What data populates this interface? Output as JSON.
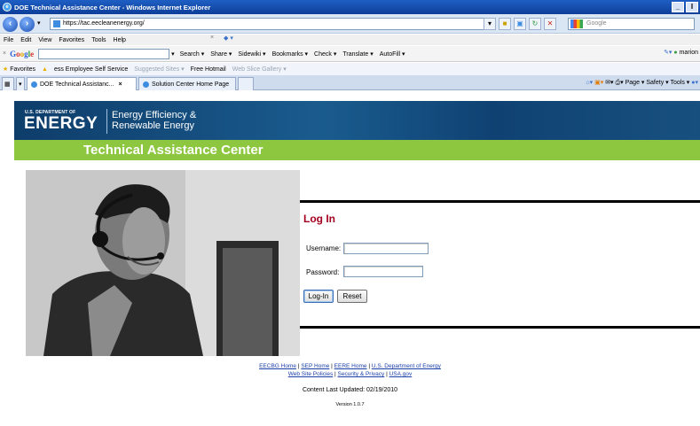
{
  "window": {
    "title": "DOE Technical Assistance Center - Windows Internet Explorer",
    "min": "_",
    "max": "I"
  },
  "address_bar": {
    "url": "https://tac.eecleanenergy.org/",
    "search_placeholder": "Google"
  },
  "menu": {
    "items": [
      "File",
      "Edit",
      "View",
      "Favorites",
      "Tools",
      "Help"
    ]
  },
  "google_toolbar": {
    "x": "×",
    "tools": [
      "Search ▾",
      "Share ▾",
      "Sidewiki ▾",
      "Bookmarks ▾",
      "Check ▾",
      "Translate ▾",
      "AutoFill ▾"
    ],
    "user": "marion"
  },
  "favorites_bar": {
    "label": "Favorites",
    "items": [
      "ess Employee Self Service",
      "Suggested Sites ▾",
      "Free Hotmail",
      "Web Slice Gallery ▾"
    ]
  },
  "tabs": [
    {
      "label": "DOE Technical Assistanc...",
      "close": "×"
    },
    {
      "label": "Solution Center Home Page"
    }
  ],
  "command_bar": "Page ▾  Safety ▾  Tools ▾",
  "page": {
    "doe_small": "U.S. DEPARTMENT OF",
    "doe_big": "ENERGY",
    "program_line1": "Energy Efficiency &",
    "program_line2": "Renewable Energy",
    "banner": "Technical Assistance Center"
  },
  "login": {
    "title": "Log In",
    "username_label": "Username:",
    "password_label": "Password:",
    "username_value": "",
    "password_value": "",
    "login_button": "Log-In",
    "reset_button": "Reset"
  },
  "footer": {
    "links_row1": [
      "EECBG Home",
      "SEP Home",
      "EERE Home",
      "U.S. Department of Energy"
    ],
    "links_row2": [
      "Web Site Policies",
      "Security & Privacy",
      "USA.gov"
    ],
    "separator": " | ",
    "updated": "Content Last Updated: 02/19/2010",
    "version": "Version 1.0.7"
  }
}
